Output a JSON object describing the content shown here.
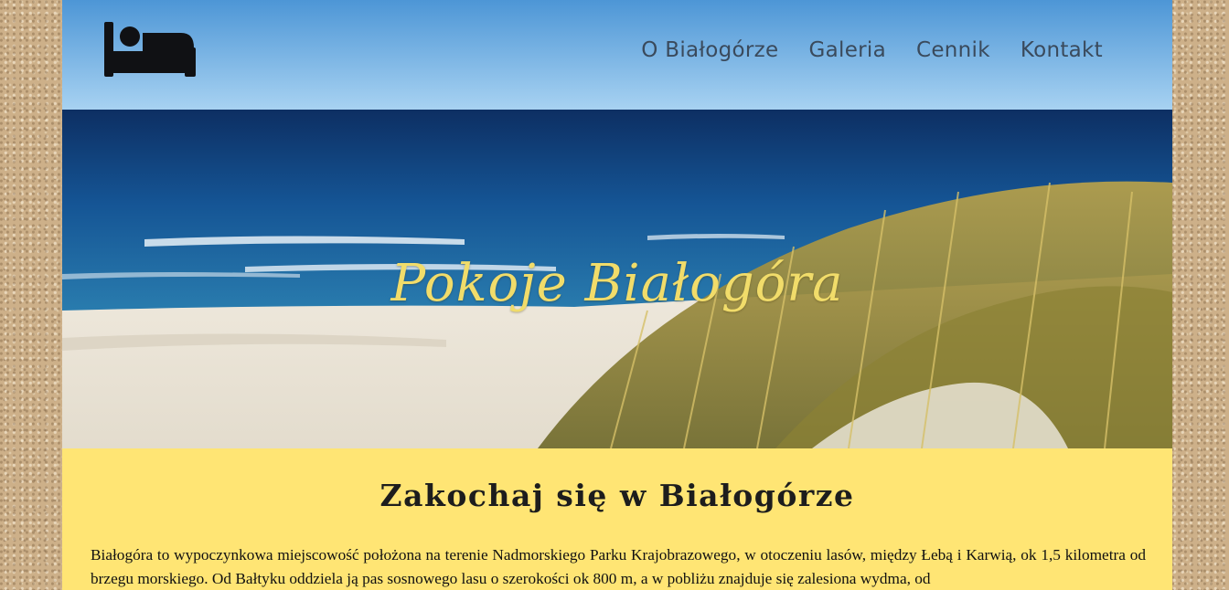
{
  "nav": {
    "logo_icon": "bed-icon",
    "items": [
      "O Białogórze",
      "Galeria",
      "Cennik",
      "Kontakt"
    ]
  },
  "hero": {
    "title": "Pokoje Białogóra",
    "image": "sea beach with dune grass photo"
  },
  "intro": {
    "heading": "Zakochaj się w Białogórze",
    "text": "Białogóra to wypoczynkowa miejscowość położona na terenie Nadmorskiego Parku Krajobrazowego, w otoczeniu lasów, między Łebą i Karwią, ok 1,5 kilometra od brzegu morskiego. Od Bałtyku oddziela ją pas sosnowego lasu o szerokości ok 800 m, a w pobliżu znajduje się zalesiona wydma, od"
  },
  "colors": {
    "accent_yellow": "#ffe574",
    "title_yellow": "#f1dc6a",
    "nav_text": "#3a4a5c",
    "sea_blue": "#14407a"
  }
}
